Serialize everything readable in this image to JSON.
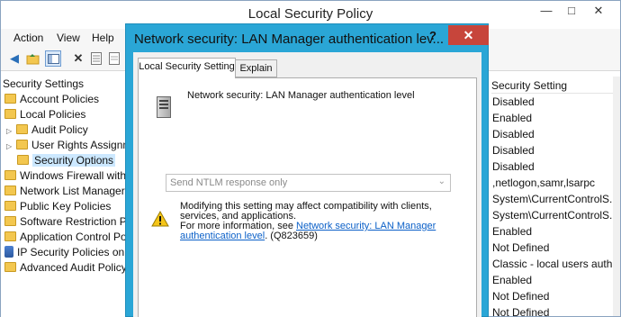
{
  "main_window": {
    "title": "Local Security Policy",
    "controls": [
      "—",
      "□",
      "✕"
    ]
  },
  "menu": [
    "Action",
    "View",
    "Help"
  ],
  "tree": [
    {
      "label": "Security Settings",
      "indent": 0,
      "icon": "none"
    },
    {
      "label": "Account Policies",
      "indent": 1,
      "icon": "folder"
    },
    {
      "label": "Local Policies",
      "indent": 1,
      "icon": "folder"
    },
    {
      "label": "Audit Policy",
      "indent": 2,
      "icon": "folder",
      "expander": true
    },
    {
      "label": "User Rights Assignment",
      "indent": 2,
      "icon": "folder",
      "expander": true
    },
    {
      "label": "Security Options",
      "indent": 2,
      "icon": "folder",
      "selected": true
    },
    {
      "label": "Windows Firewall with Advanced Security",
      "indent": 1,
      "icon": "folder"
    },
    {
      "label": "Network List Manager Policies",
      "indent": 1,
      "icon": "folder"
    },
    {
      "label": "Public Key Policies",
      "indent": 1,
      "icon": "folder"
    },
    {
      "label": "Software Restriction Policies",
      "indent": 1,
      "icon": "folder"
    },
    {
      "label": "Application Control Policies",
      "indent": 1,
      "icon": "folder"
    },
    {
      "label": "IP Security Policies on Local Computer",
      "indent": 1,
      "icon": "ipsec"
    },
    {
      "label": "Advanced Audit Policy Configuration",
      "indent": 1,
      "icon": "folder"
    }
  ],
  "list": {
    "header": "Security Setting",
    "values": [
      "Disabled",
      "Enabled",
      "Disabled",
      "Disabled",
      "Disabled",
      ",netlogon,samr,lsarpc",
      "System\\CurrentControlS...",
      "System\\CurrentControlS...",
      "Enabled",
      "Not Defined",
      "Classic - local users auth...",
      "Enabled",
      "Not Defined",
      "Not Defined"
    ]
  },
  "dialog": {
    "title": "Network security: LAN Manager authentication lev...",
    "help": "?",
    "close": "✕",
    "tabs": [
      "Local Security Setting",
      "Explain"
    ],
    "policy_name": "Network security: LAN Manager authentication level",
    "dropdown_value": "Send NTLM response only",
    "warning_line1": "Modifying this setting may affect compatibility with clients, services, and applications.",
    "warning_prefix": "For more information, see ",
    "warning_link": "Network security: LAN Manager authentication level",
    "warning_suffix": ". (Q823659)"
  },
  "colors": {
    "dialog_frame": "#2aa6d6",
    "close_button": "#c7453b",
    "selection": "#cce8ff",
    "link": "#0b60c8"
  }
}
